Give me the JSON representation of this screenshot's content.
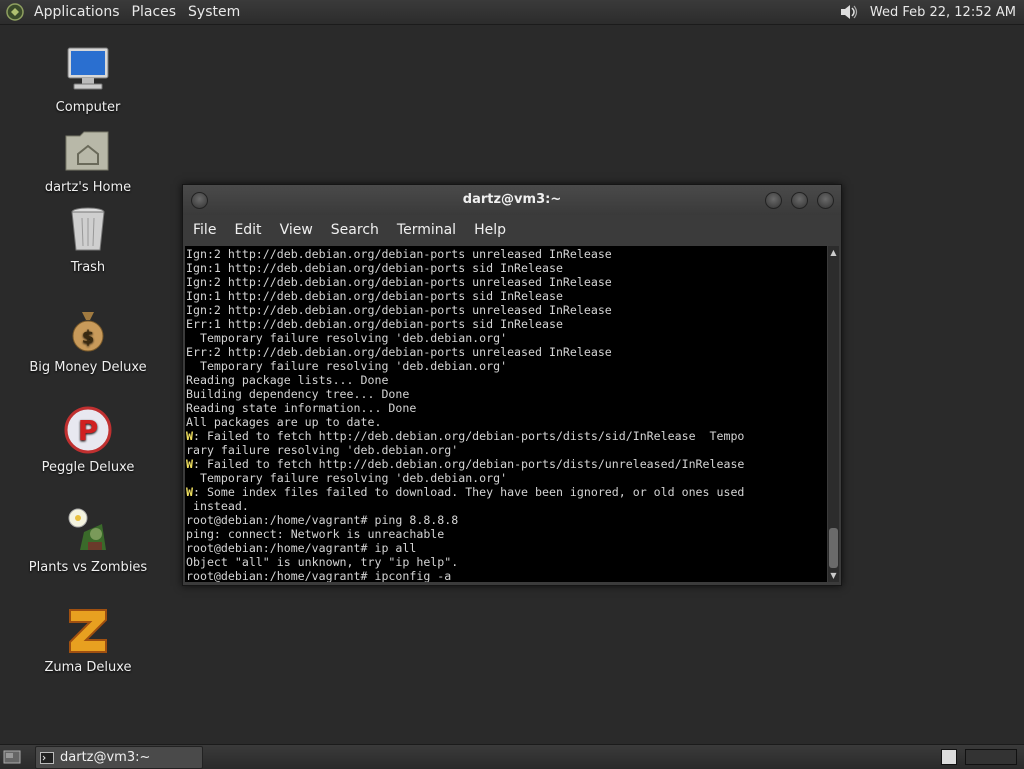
{
  "top_panel": {
    "menus": [
      "Applications",
      "Places",
      "System"
    ],
    "clock": "Wed Feb 22, 12:52 AM"
  },
  "desktop_icons": [
    {
      "label": "Computer",
      "icon": "computer-icon"
    },
    {
      "label": "dartz's Home",
      "icon": "home-folder-icon"
    },
    {
      "label": "Trash",
      "icon": "trash-icon"
    },
    {
      "label": "Big Money Deluxe",
      "icon": "money-bag-icon"
    },
    {
      "label": "Peggle Deluxe",
      "icon": "peggle-icon"
    },
    {
      "label": "Plants vs Zombies",
      "icon": "plants-vs-zombies-icon"
    },
    {
      "label": "Zuma Deluxe",
      "icon": "zuma-icon"
    }
  ],
  "terminal": {
    "title": "dartz@vm3:~",
    "menu": [
      "File",
      "Edit",
      "View",
      "Search",
      "Terminal",
      "Help"
    ],
    "lines": [
      "Ign:2 http://deb.debian.org/debian-ports unreleased InRelease",
      "Ign:1 http://deb.debian.org/debian-ports sid InRelease",
      "Ign:2 http://deb.debian.org/debian-ports unreleased InRelease",
      "Ign:1 http://deb.debian.org/debian-ports sid InRelease",
      "Ign:2 http://deb.debian.org/debian-ports unreleased InRelease",
      "Err:1 http://deb.debian.org/debian-ports sid InRelease",
      "  Temporary failure resolving 'deb.debian.org'",
      "Err:2 http://deb.debian.org/debian-ports unreleased InRelease",
      "  Temporary failure resolving 'deb.debian.org'",
      "Reading package lists... Done",
      "Building dependency tree... Done",
      "Reading state information... Done",
      "All packages are up to date.",
      "W: Failed to fetch http://deb.debian.org/debian-ports/dists/sid/InRelease  Tempo",
      "rary failure resolving 'deb.debian.org'",
      "W: Failed to fetch http://deb.debian.org/debian-ports/dists/unreleased/InRelease",
      "  Temporary failure resolving 'deb.debian.org'",
      "W: Some index files failed to download. They have been ignored, or old ones used",
      " instead.",
      "root@debian:/home/vagrant# ping 8.8.8.8",
      "ping: connect: Network is unreachable",
      "root@debian:/home/vagrant# ip all",
      "Object \"all\" is unknown, try \"ip help\".",
      "root@debian:/home/vagrant# ipconfig -a"
    ]
  },
  "taskbar": {
    "task_label": "dartz@vm3:~"
  }
}
